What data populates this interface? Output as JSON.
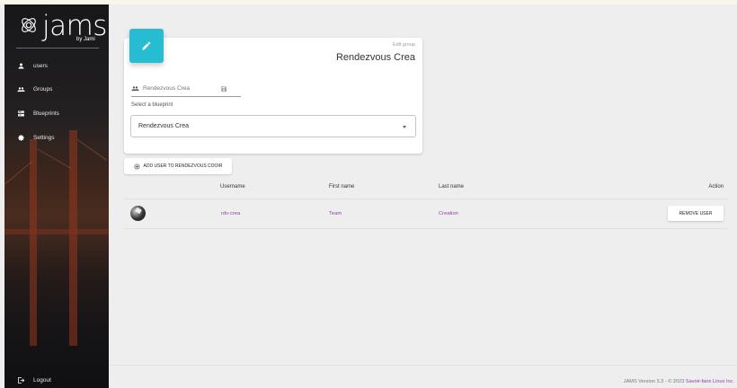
{
  "app": {
    "logo_text": "jams",
    "logo_sub": "by Jami"
  },
  "sidebar": {
    "items": [
      {
        "label": "users",
        "icon": "person-icon"
      },
      {
        "label": "Groups",
        "icon": "group-icon"
      },
      {
        "label": "Blueprints",
        "icon": "blueprint-icon"
      },
      {
        "label": "Settings",
        "icon": "gear-icon"
      }
    ],
    "logout_label": "Logout"
  },
  "group_card": {
    "caption": "Edit group",
    "title": "Rendezvous Crea",
    "name_placeholder": "Rendezvous Crea",
    "blueprint_label": "Select a blueprint",
    "blueprint_selected": "Rendezvous Crea"
  },
  "add_user_button": "ADD USER TO RENDEZVOUS COOIR",
  "table": {
    "headers": {
      "username": "Username",
      "first_name": "First name",
      "last_name": "Last name",
      "action": "Action"
    },
    "rows": [
      {
        "username": "rdv-crea",
        "first_name": "Team",
        "last_name": "Creation",
        "action": "REMOVE USER"
      }
    ]
  },
  "footer": {
    "prefix": "JAMS Version 3.3 - © 2023 ",
    "link": "Savoir-faire Linux Inc."
  },
  "colors": {
    "accent": "#26bcd1",
    "link": "#8a46a8",
    "background": "#eeeeee"
  }
}
